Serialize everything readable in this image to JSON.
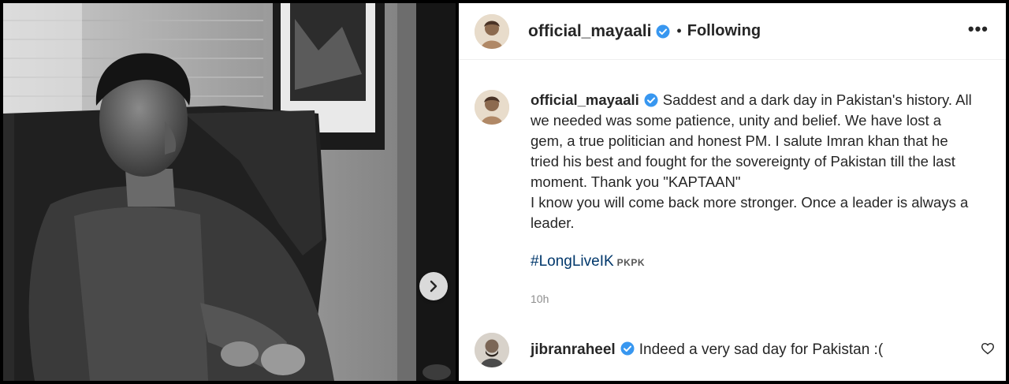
{
  "post": {
    "author": "official_mayaali",
    "follow_status": "Following",
    "separator": "•",
    "more_label": "•••"
  },
  "caption": {
    "author": "official_mayaali",
    "lines": [
      "Saddest and a dark day in Pakistan's history. All",
      "we needed was some patience, unity and belief. We have lost a",
      "gem, a true politician and honest PM. I salute Imran khan that he",
      "tried his best and fought for the sovereignty of Pakistan till the last",
      "moment. Thank you \"KAPTAAN\"",
      "I know you will come back more stronger. Once a leader is always a",
      "leader."
    ],
    "hashtag": "#LongLiveIK",
    "tag_suffix": "PKPK",
    "time": "10h"
  },
  "comment": {
    "author": "jibranraheel",
    "text": "Indeed a very sad day for Pakistan :("
  },
  "icons": {
    "verified": "verified-badge-icon",
    "next": "chevron-right-icon",
    "like": "heart-outline-icon"
  },
  "colors": {
    "verified": "#3897f0",
    "hashtag": "#00376b",
    "text": "#262626",
    "muted": "#8e8e8e"
  }
}
